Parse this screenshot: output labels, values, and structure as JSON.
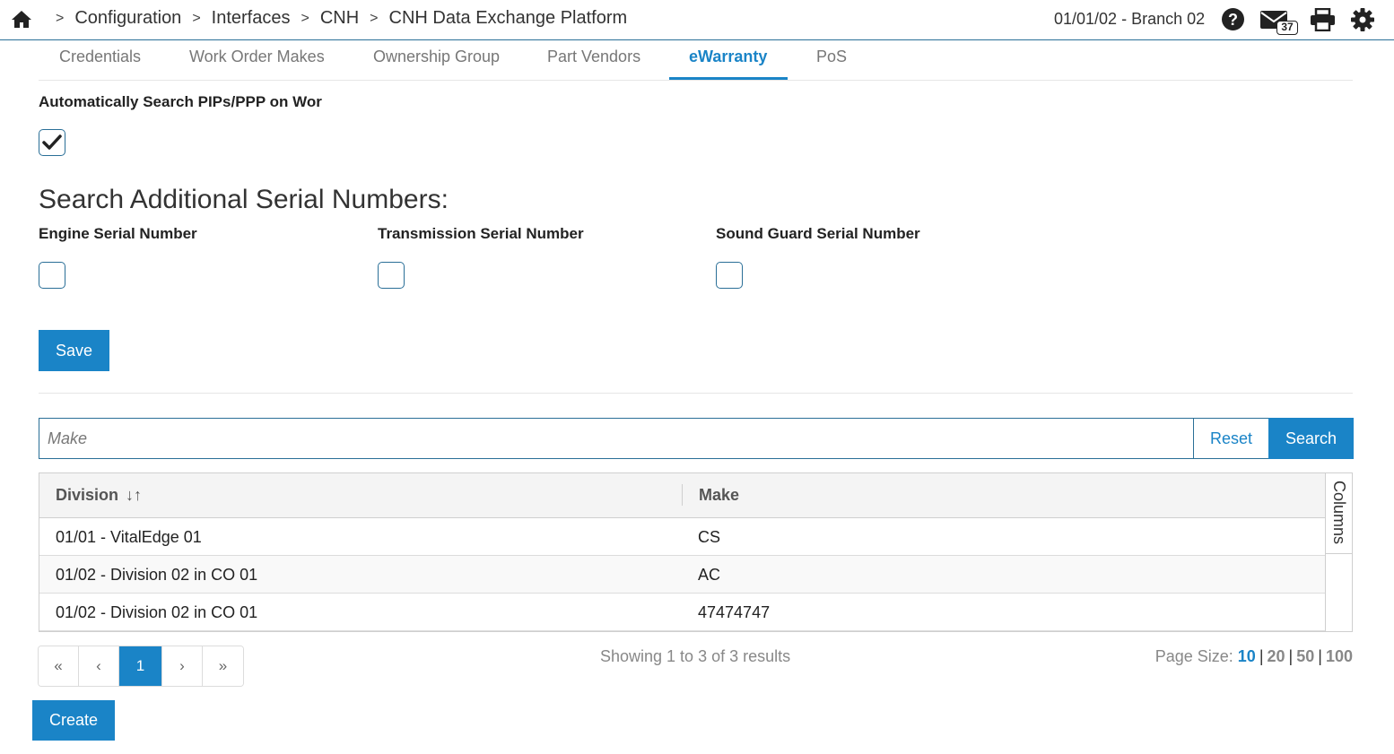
{
  "header": {
    "breadcrumb": [
      {
        "label": "Configuration"
      },
      {
        "label": "Interfaces"
      },
      {
        "label": "CNH"
      },
      {
        "label": "CNH Data Exchange Platform"
      }
    ],
    "separator": ">",
    "branch": "01/01/02 - Branch 02",
    "mail_count": "37",
    "icons": [
      "home-icon",
      "help-icon",
      "mail-icon",
      "print-icon",
      "gear-icon"
    ]
  },
  "tabs": [
    {
      "label": "Credentials",
      "active": false
    },
    {
      "label": "Work Order Makes",
      "active": false
    },
    {
      "label": "Ownership Group",
      "active": false
    },
    {
      "label": "Part Vendors",
      "active": false
    },
    {
      "label": "eWarranty",
      "active": true
    },
    {
      "label": "PoS",
      "active": false
    }
  ],
  "form": {
    "auto_search_label": "Automatically Search PIPs/PPP on Wor",
    "auto_search_checked": true,
    "section_title": "Search Additional Serial Numbers:",
    "engine_label": "Engine Serial Number",
    "engine_checked": false,
    "transmission_label": "Transmission Serial Number",
    "transmission_checked": false,
    "soundguard_label": "Sound Guard Serial Number",
    "soundguard_checked": false,
    "save_label": "Save"
  },
  "search": {
    "placeholder": "Make",
    "value": "",
    "reset_label": "Reset",
    "search_label": "Search"
  },
  "table": {
    "columns": [
      {
        "label": "Division",
        "sortable": true
      },
      {
        "label": "Make",
        "sortable": false
      }
    ],
    "sort_icon": "↓↑",
    "rows": [
      {
        "division": "01/01 - VitalEdge 01",
        "make": "CS"
      },
      {
        "division": "01/02 - Division 02 in CO 01",
        "make": "AC"
      },
      {
        "division": "01/02 - Division 02 in CO 01",
        "make": "47474747"
      }
    ],
    "columns_toggle_label": "Columns"
  },
  "pagination": {
    "first": "«",
    "prev": "‹",
    "current": "1",
    "next": "›",
    "last": "»",
    "showing": "Showing 1 to 3 of 3 results",
    "page_size_label": "Page Size:",
    "page_sizes": [
      "10",
      "20",
      "50",
      "100"
    ],
    "selected_page_size": "10"
  },
  "create_label": "Create",
  "colors": {
    "accent": "#1a84c7",
    "border_dark": "#2a6f97"
  }
}
